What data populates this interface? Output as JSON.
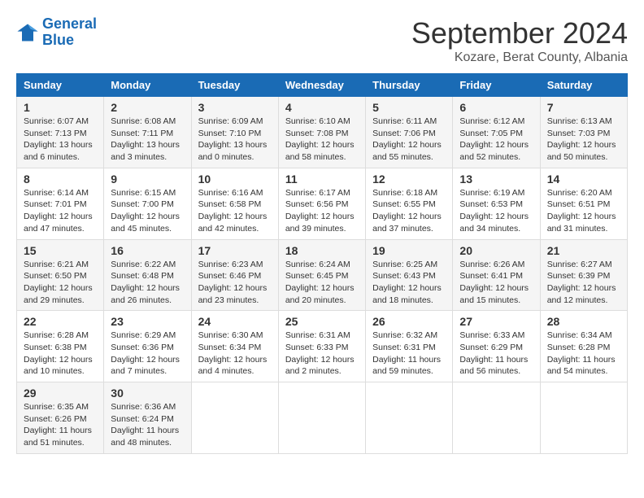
{
  "header": {
    "logo": {
      "line1": "General",
      "line2": "Blue"
    },
    "month": "September 2024",
    "location": "Kozare, Berat County, Albania"
  },
  "weekdays": [
    "Sunday",
    "Monday",
    "Tuesday",
    "Wednesday",
    "Thursday",
    "Friday",
    "Saturday"
  ],
  "weeks": [
    [
      {
        "day": "1",
        "sunrise": "6:07 AM",
        "sunset": "7:13 PM",
        "daylight": "13 hours and 6 minutes."
      },
      {
        "day": "2",
        "sunrise": "6:08 AM",
        "sunset": "7:11 PM",
        "daylight": "13 hours and 3 minutes."
      },
      {
        "day": "3",
        "sunrise": "6:09 AM",
        "sunset": "7:10 PM",
        "daylight": "13 hours and 0 minutes."
      },
      {
        "day": "4",
        "sunrise": "6:10 AM",
        "sunset": "7:08 PM",
        "daylight": "12 hours and 58 minutes."
      },
      {
        "day": "5",
        "sunrise": "6:11 AM",
        "sunset": "7:06 PM",
        "daylight": "12 hours and 55 minutes."
      },
      {
        "day": "6",
        "sunrise": "6:12 AM",
        "sunset": "7:05 PM",
        "daylight": "12 hours and 52 minutes."
      },
      {
        "day": "7",
        "sunrise": "6:13 AM",
        "sunset": "7:03 PM",
        "daylight": "12 hours and 50 minutes."
      }
    ],
    [
      {
        "day": "8",
        "sunrise": "6:14 AM",
        "sunset": "7:01 PM",
        "daylight": "12 hours and 47 minutes."
      },
      {
        "day": "9",
        "sunrise": "6:15 AM",
        "sunset": "7:00 PM",
        "daylight": "12 hours and 45 minutes."
      },
      {
        "day": "10",
        "sunrise": "6:16 AM",
        "sunset": "6:58 PM",
        "daylight": "12 hours and 42 minutes."
      },
      {
        "day": "11",
        "sunrise": "6:17 AM",
        "sunset": "6:56 PM",
        "daylight": "12 hours and 39 minutes."
      },
      {
        "day": "12",
        "sunrise": "6:18 AM",
        "sunset": "6:55 PM",
        "daylight": "12 hours and 37 minutes."
      },
      {
        "day": "13",
        "sunrise": "6:19 AM",
        "sunset": "6:53 PM",
        "daylight": "12 hours and 34 minutes."
      },
      {
        "day": "14",
        "sunrise": "6:20 AM",
        "sunset": "6:51 PM",
        "daylight": "12 hours and 31 minutes."
      }
    ],
    [
      {
        "day": "15",
        "sunrise": "6:21 AM",
        "sunset": "6:50 PM",
        "daylight": "12 hours and 29 minutes."
      },
      {
        "day": "16",
        "sunrise": "6:22 AM",
        "sunset": "6:48 PM",
        "daylight": "12 hours and 26 minutes."
      },
      {
        "day": "17",
        "sunrise": "6:23 AM",
        "sunset": "6:46 PM",
        "daylight": "12 hours and 23 minutes."
      },
      {
        "day": "18",
        "sunrise": "6:24 AM",
        "sunset": "6:45 PM",
        "daylight": "12 hours and 20 minutes."
      },
      {
        "day": "19",
        "sunrise": "6:25 AM",
        "sunset": "6:43 PM",
        "daylight": "12 hours and 18 minutes."
      },
      {
        "day": "20",
        "sunrise": "6:26 AM",
        "sunset": "6:41 PM",
        "daylight": "12 hours and 15 minutes."
      },
      {
        "day": "21",
        "sunrise": "6:27 AM",
        "sunset": "6:39 PM",
        "daylight": "12 hours and 12 minutes."
      }
    ],
    [
      {
        "day": "22",
        "sunrise": "6:28 AM",
        "sunset": "6:38 PM",
        "daylight": "12 hours and 10 minutes."
      },
      {
        "day": "23",
        "sunrise": "6:29 AM",
        "sunset": "6:36 PM",
        "daylight": "12 hours and 7 minutes."
      },
      {
        "day": "24",
        "sunrise": "6:30 AM",
        "sunset": "6:34 PM",
        "daylight": "12 hours and 4 minutes."
      },
      {
        "day": "25",
        "sunrise": "6:31 AM",
        "sunset": "6:33 PM",
        "daylight": "12 hours and 2 minutes."
      },
      {
        "day": "26",
        "sunrise": "6:32 AM",
        "sunset": "6:31 PM",
        "daylight": "11 hours and 59 minutes."
      },
      {
        "day": "27",
        "sunrise": "6:33 AM",
        "sunset": "6:29 PM",
        "daylight": "11 hours and 56 minutes."
      },
      {
        "day": "28",
        "sunrise": "6:34 AM",
        "sunset": "6:28 PM",
        "daylight": "11 hours and 54 minutes."
      }
    ],
    [
      {
        "day": "29",
        "sunrise": "6:35 AM",
        "sunset": "6:26 PM",
        "daylight": "11 hours and 51 minutes."
      },
      {
        "day": "30",
        "sunrise": "6:36 AM",
        "sunset": "6:24 PM",
        "daylight": "11 hours and 48 minutes."
      },
      null,
      null,
      null,
      null,
      null
    ]
  ],
  "labels": {
    "sunrise": "Sunrise:",
    "sunset": "Sunset:",
    "daylight": "Daylight:"
  }
}
